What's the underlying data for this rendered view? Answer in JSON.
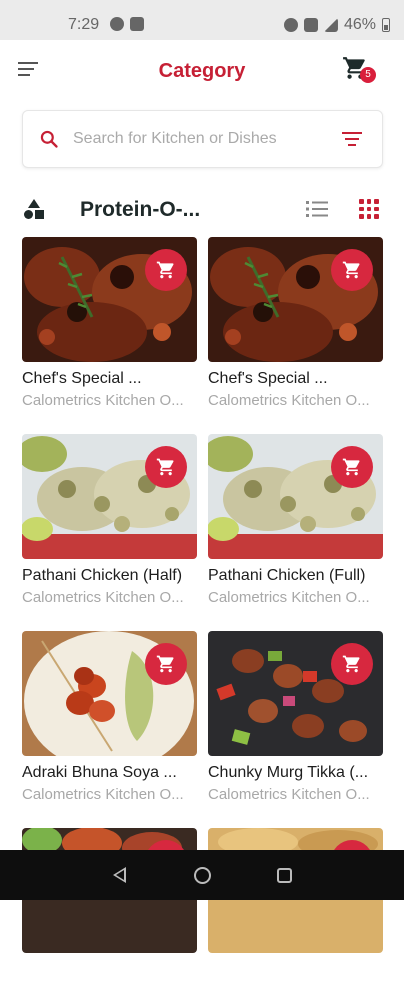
{
  "status_bar": {
    "time": "7:29",
    "battery": "46%"
  },
  "header": {
    "title": "Category",
    "cart_count": "5"
  },
  "search": {
    "placeholder": "Search for Kitchen or Dishes",
    "value": ""
  },
  "section": {
    "title": "Protein-O-..."
  },
  "products": [
    {
      "name": "Chef's Special ...",
      "kitchen": "Calometrics Kitchen O...",
      "image": "grilled-chicken-rosemary"
    },
    {
      "name": "Chef's Special ...",
      "kitchen": "Calometrics Kitchen O...",
      "image": "grilled-chicken-rosemary"
    },
    {
      "name": "Pathani Chicken (Half)",
      "kitchen": "Calometrics Kitchen O...",
      "image": "chicken-malai-tikka"
    },
    {
      "name": "Pathani Chicken (Full)",
      "kitchen": "Calometrics Kitchen O...",
      "image": "chicken-malai-tikka"
    },
    {
      "name": "Adraki Bhuna Soya ...",
      "kitchen": "Calometrics Kitchen O...",
      "image": "soya-skewers-chutney"
    },
    {
      "name": "Chunky Murg Tikka (...",
      "kitchen": "Calometrics Kitchen O...",
      "image": "murg-tikka-peppers"
    },
    {
      "name": "",
      "kitchen": "",
      "image": "tandoori-plate"
    },
    {
      "name": "",
      "kitchen": "",
      "image": "fried-food"
    }
  ],
  "colors": {
    "accent": "#c62035",
    "cart_button": "#d7283f"
  }
}
